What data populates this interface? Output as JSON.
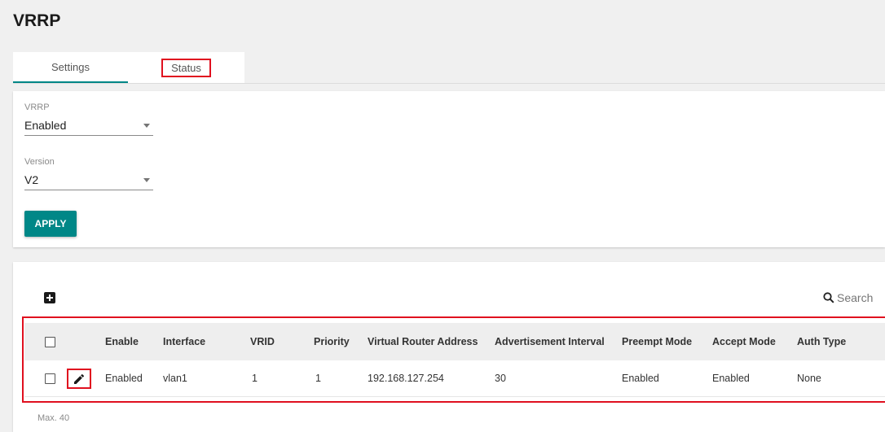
{
  "page": {
    "title": "VRRP"
  },
  "tabs": [
    {
      "label": "Settings",
      "active": true
    },
    {
      "label": "Status",
      "active": false
    }
  ],
  "settings": {
    "vrrp": {
      "label": "VRRP",
      "value": "Enabled"
    },
    "version": {
      "label": "Version",
      "value": "V2"
    },
    "apply_label": "APPLY"
  },
  "table": {
    "search_placeholder": "Search",
    "columns": [
      "Enable",
      "Interface",
      "VRID",
      "Priority",
      "Virtual Router Address",
      "Advertisement Interval",
      "Preempt Mode",
      "Accept Mode",
      "Auth Type"
    ],
    "rows": [
      {
        "enable": "Enabled",
        "interface": "vlan1",
        "vrid": "1",
        "priority": "1",
        "virtual_router_address": "192.168.127.254",
        "advertisement_interval": "30",
        "preempt_mode": "Enabled",
        "accept_mode": "Enabled",
        "auth_type": "None"
      }
    ],
    "max_note": "Max. 40"
  },
  "colors": {
    "accent": "#008787",
    "highlight": "#e0101f"
  },
  "icons": {
    "add": "add-box-icon",
    "edit": "pencil-icon",
    "search": "search-icon",
    "dropdown": "chevron-down-icon"
  }
}
